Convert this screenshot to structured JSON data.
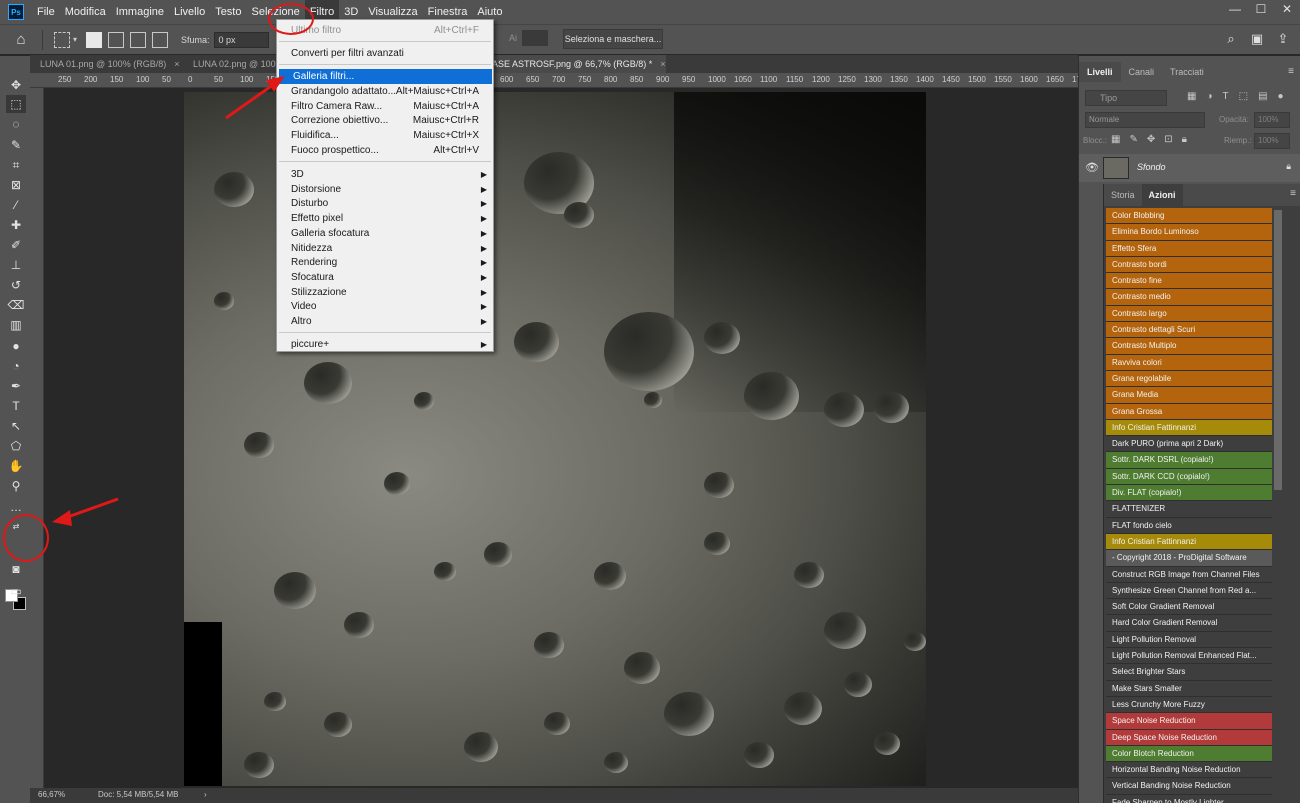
{
  "app": {
    "logo": "Ps"
  },
  "menubar": {
    "items": [
      "File",
      "Modifica",
      "Immagine",
      "Livello",
      "Testo",
      "Selezione",
      "Filtro",
      "3D",
      "Visualizza",
      "Finestra",
      "Aiuto"
    ],
    "window_controls": [
      "—",
      "☐",
      "✕"
    ]
  },
  "options": {
    "feather_label": "Sfuma:",
    "feather_value": "0 px",
    "antialias_label": "Ai",
    "mask_button": "Seleziona e maschera..."
  },
  "tabs": [
    {
      "label": "LUNA 01.png @ 100% (RGB/8)",
      "close": "×"
    },
    {
      "label": "LUNA 02.png @ 100% (RGB/8)",
      "close": "×"
    },
    {
      "label": "BASE ASTROSF.png @ 66,7% (RGB/8) *",
      "close": "×"
    }
  ],
  "ruler": {
    "top": [
      "250",
      "200",
      "150",
      "100",
      "50",
      "0",
      "50",
      "100",
      "150",
      "200",
      "250",
      "300",
      "350",
      "400",
      "450",
      "500",
      "550",
      "600",
      "650",
      "700",
      "750",
      "800",
      "850",
      "900",
      "950",
      "1000",
      "1050",
      "1100",
      "1150",
      "1200",
      "1250",
      "1300",
      "1350",
      "1400",
      "1450",
      "1500",
      "1550",
      "1600",
      "1650",
      "1700"
    ]
  },
  "statusbar": {
    "zoom": "66,67%",
    "doc": "Doc: 5,54 MB/5,54 MB",
    "arrow": "›"
  },
  "filter_menu": {
    "last_filter": {
      "label": "Ultimo filtro",
      "shortcut": "Alt+Ctrl+F"
    },
    "convert": "Converti per filtri avanzati",
    "group1": [
      {
        "label": "Galleria filtri...",
        "shortcut": ""
      },
      {
        "label": "Grandangolo adattato...",
        "shortcut": "Alt+Maiusc+Ctrl+A"
      },
      {
        "label": "Filtro Camera Raw...",
        "shortcut": "Maiusc+Ctrl+A"
      },
      {
        "label": "Correzione obiettivo...",
        "shortcut": "Maiusc+Ctrl+R"
      },
      {
        "label": "Fluidifica...",
        "shortcut": "Maiusc+Ctrl+X"
      },
      {
        "label": "Fuoco prospettico...",
        "shortcut": "Alt+Ctrl+V"
      }
    ],
    "submenus": [
      "3D",
      "Distorsione",
      "Disturbo",
      "Effetto pixel",
      "Galleria sfocatura",
      "Nitidezza",
      "Rendering",
      "Sfocatura",
      "Stilizzazione",
      "Video",
      "Altro"
    ],
    "plugins": [
      "piccure+"
    ]
  },
  "layers_panel": {
    "tabs": [
      "Livelli",
      "Canali",
      "Tracciati"
    ],
    "kind_placeholder": "Tipo",
    "blend_mode": "Normale",
    "opacity_label": "Opacità:",
    "opacity_value": "100%",
    "lock_label": "Blocc.:",
    "fill_label": "Riemp.:",
    "fill_value": "100%",
    "layer_name": "Sfondo"
  },
  "actions_panel": {
    "tabs": [
      "Storia",
      "Azioni"
    ],
    "items": [
      {
        "label": "Color Blobbing",
        "color": "orange"
      },
      {
        "label": "Elimina Bordo Luminoso",
        "color": "orange"
      },
      {
        "label": "Effetto Sfera",
        "color": "orange"
      },
      {
        "label": "Contrasto bordi",
        "color": "orange"
      },
      {
        "label": "Contrasto fine",
        "color": "orange"
      },
      {
        "label": "Contrasto medio",
        "color": "orange"
      },
      {
        "label": "Contrasto largo",
        "color": "orange"
      },
      {
        "label": "Contrasto dettagli Scuri",
        "color": "orange"
      },
      {
        "label": "Contrasto Multiplo",
        "color": "orange"
      },
      {
        "label": "Ravviva colori",
        "color": "orange"
      },
      {
        "label": "Grana regolabile",
        "color": "orange"
      },
      {
        "label": "Grana Media",
        "color": "orange"
      },
      {
        "label": "Grana Grossa",
        "color": "orange"
      },
      {
        "label": "Info Cristian Fattinnanzi",
        "color": "gold"
      },
      {
        "label": "Dark PURO (prima apri 2 Dark)",
        "color": "gray"
      },
      {
        "label": "Sottr. DARK DSRL (copialo!)",
        "color": "green"
      },
      {
        "label": "Sottr. DARK CCD (copialo!)",
        "color": "green"
      },
      {
        "label": "Div. FLAT (copialo!)",
        "color": "green"
      },
      {
        "label": "FLATTENIZER",
        "color": "gray"
      },
      {
        "label": "FLAT fondo cielo",
        "color": "gray"
      },
      {
        "label": "Info Cristian Fattinnanzi",
        "color": "gold"
      },
      {
        "label": "- Copyright 2018 - ProDigital Software",
        "color": "set"
      },
      {
        "label": "Construct RGB Image from Channel Files",
        "color": "gray"
      },
      {
        "label": "Synthesize Green Channel from Red a...",
        "color": "gray"
      },
      {
        "label": "Soft Color Gradient Removal",
        "color": "gray"
      },
      {
        "label": "Hard Color Gradient Removal",
        "color": "gray"
      },
      {
        "label": "Light Pollution Removal",
        "color": "gray"
      },
      {
        "label": "Light Pollution Removal Enhanced Flat...",
        "color": "gray"
      },
      {
        "label": "Select Brighter Stars",
        "color": "gray"
      },
      {
        "label": "Make Stars Smaller",
        "color": "gray"
      },
      {
        "label": "Less Crunchy More Fuzzy",
        "color": "gray"
      },
      {
        "label": "Space Noise Reduction",
        "color": "red"
      },
      {
        "label": "Deep Space Noise Reduction",
        "color": "red"
      },
      {
        "label": "Color Blotch Reduction",
        "color": "green"
      },
      {
        "label": "Horizontal Banding Noise Reduction",
        "color": "gray"
      },
      {
        "label": "Vertical Banding Noise Reduction",
        "color": "gray"
      },
      {
        "label": "Fade Sharpen to Mostly Lighter",
        "color": "gray"
      }
    ]
  },
  "colors": {
    "accent": "#0f6fd6",
    "annotation": "#e01818",
    "foreground_swatch": "#ffffff",
    "background_swatch": "#000000"
  }
}
